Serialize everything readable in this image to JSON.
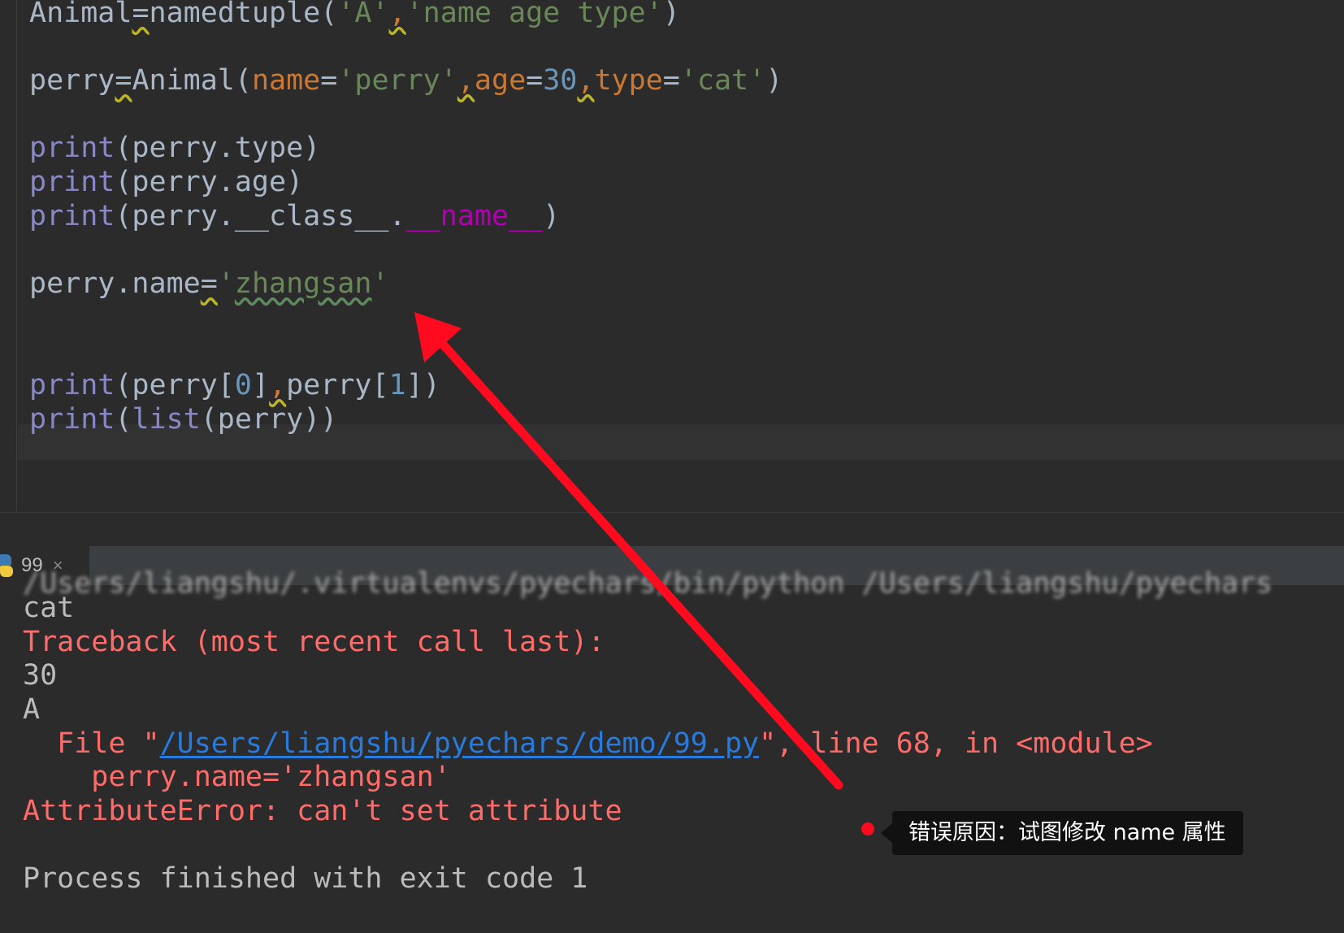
{
  "editor": {
    "lines": {
      "l1": {
        "t1": "Animal",
        "t2": "=",
        "t3": "namedtuple(",
        "t4": "'A'",
        "t5": ",",
        "t6": "'name age type'",
        "t7": ")"
      },
      "l2": {
        "t1": "perry",
        "t2": "=",
        "t3": "Animal(",
        "t4": "name",
        "t5": "=",
        "t6": "'perry'",
        "t7": ",",
        "t8": "age",
        "t9": "=",
        "t10": "30",
        "t11": ",",
        "t12": "type",
        "t13": "=",
        "t14": "'cat'",
        "t15": ")"
      },
      "l3": {
        "t1": "print",
        "t2": "(perry.type)"
      },
      "l4": {
        "t1": "print",
        "t2": "(perry.age)"
      },
      "l5": {
        "t1": "print",
        "t2": "(perry.__class__.",
        "t3": "__name__",
        "t4": ")"
      },
      "l6": {
        "t1": "perry.name",
        "t2": "=",
        "t3": "'",
        "t4": "zhangsan",
        "t5": "'"
      },
      "l7": {
        "t1": "print",
        "t2": "(perry[",
        "t3": "0",
        "t4": "]",
        "t5": ",",
        "t6": "perry[",
        "t7": "1",
        "t8": "])"
      },
      "l8": {
        "t1": "print",
        "t2": "(",
        "t3": "list",
        "t4": "(perry))"
      }
    }
  },
  "run_panel": {
    "tab_label": "99",
    "tab_close": "×"
  },
  "console": {
    "path_line": "/Users/liangshu/.virtualenvs/pyechars/bin/python /Users/liangshu/pyechars",
    "out1": "cat",
    "traceback": "Traceback (most recent call last):",
    "out2": "30",
    "out3": "A",
    "file_prefix": "  File \"",
    "file_link": "/Users/liangshu/pyechars/demo/99.py",
    "file_suffix": "\", line 68, in <module>",
    "code_echo": "    perry.name='zhangsan'",
    "error": "AttributeError: can't set attribute",
    "finished": "Process finished with exit code 1"
  },
  "annotation": {
    "tooltip": "错误原因：试图修改 name 属性",
    "arrow_color": "#ff0a1e"
  }
}
